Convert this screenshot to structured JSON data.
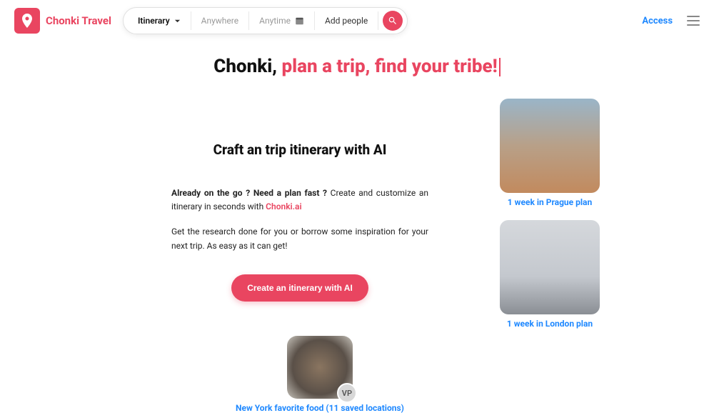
{
  "brand": {
    "name": "Chonki Travel"
  },
  "searchbar": {
    "type_label": "Itinerary",
    "where_placeholder": "Anywhere",
    "when_placeholder": "Anytime",
    "who_placeholder": "Add people"
  },
  "header": {
    "access": "Access"
  },
  "hero": {
    "lead": "Chonki, ",
    "accent": "plan a trip, find your tribe!"
  },
  "intro": {
    "heading": "Craft an trip itinerary with AI",
    "p1_bold": "Already on the go ? Need a plan fast ?",
    "p1_rest": " Create and customize an itinerary in seconds with ",
    "p1_link": "Chonki.ai",
    "p2": "Get the research done for you or borrow some inspiration for your next trip. As easy as it can get!",
    "cta": "Create an itinerary with AI"
  },
  "plans": [
    {
      "title": "1 week in Prague plan"
    },
    {
      "title": "1 week in London plan"
    }
  ],
  "footer_card": {
    "title": "New York favorite food (11 saved locations)",
    "avatar_initials": "VP"
  }
}
